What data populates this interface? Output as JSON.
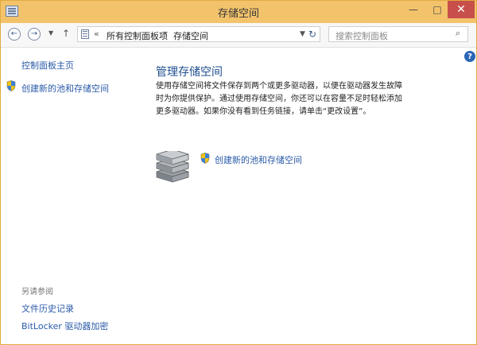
{
  "window": {
    "title": "存储空间",
    "controls": {
      "minimize": "—",
      "maximize": "□",
      "close": "✕"
    }
  },
  "navigation": {
    "back_glyph": "←",
    "forward_glyph": "→",
    "recent_glyph": "▼",
    "up_glyph": "↑",
    "address": {
      "separator": "«",
      "crumbs": [
        "所有控制面板项",
        "存储空间"
      ],
      "crumb_arrow": "›",
      "dropdown_glyph": "▼"
    },
    "refresh_glyph": "↻",
    "search": {
      "placeholder": "搜索控制面板",
      "icon_glyph": "⌕"
    }
  },
  "help": {
    "glyph": "?"
  },
  "sidebar": {
    "home": "控制面板主页",
    "create_pool": "创建新的池和存储空间",
    "see_also": {
      "heading": "另请参阅",
      "links": [
        "文件历史记录",
        "BitLocker 驱动器加密"
      ]
    }
  },
  "main": {
    "heading": "管理存储空间",
    "description": "使用存储空间将文件保存到两个或更多驱动器，以便在驱动器发生故障时为你提供保护。通过使用存储空间，你还可以在容量不足时轻松添加更多驱动器。如果你没有看到任务链接，请单击“更改设置”。",
    "action_link": "创建新的池和存储空间"
  },
  "colors": {
    "titlebar": "#f3c36c",
    "link": "#2a5aa8",
    "heading": "#1f4f8f",
    "close_button": "#c7504a"
  },
  "icons": {
    "app": "control-panel-icon",
    "shield": "uac-shield-icon",
    "storage": "storage-drives-icon"
  }
}
